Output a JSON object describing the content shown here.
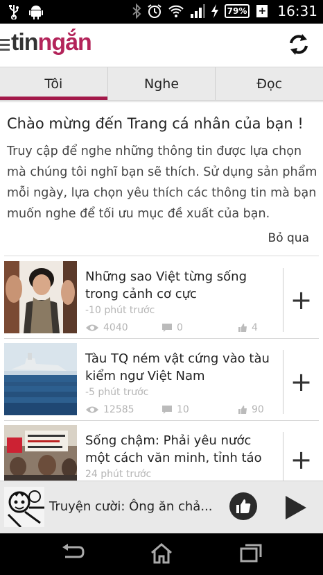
{
  "status_bar": {
    "icons": [
      "usb-icon",
      "android-icon",
      "bluetooth-icon",
      "alarm-icon",
      "wifi-icon",
      "signal-icon",
      "charging-icon"
    ],
    "battery": "79%",
    "battery_plus": "+",
    "time": "16:31"
  },
  "app_bar": {
    "logo_part1": "tin",
    "logo_part2": "ngắn",
    "refresh_icon": "refresh-icon"
  },
  "tabs": [
    {
      "label": "Tôi",
      "active": true
    },
    {
      "label": "Nghe",
      "active": false
    },
    {
      "label": "Đọc",
      "active": false
    }
  ],
  "welcome": {
    "title": "Chào mừng đến Trang cá nhân của bạn !",
    "body": "Truy cập để nghe những thông tin được lựa chọn mà chúng tôi nghĩ bạn sẽ thích. Sử dụng sản phẩm mỗi ngày, lựa chọn yêu thích các thông tin mà bạn muốn nghe để tối ưu mục đề xuất của bạn.",
    "skip": "Bỏ qua"
  },
  "news": [
    {
      "title": "Những sao Việt từng sống trong cảnh cơ cực",
      "time": "-10 phút trước",
      "views": "4040",
      "comments": "0",
      "likes": "4"
    },
    {
      "title": "Tàu TQ ném vật cứng vào tàu kiểm ngư Việt Nam",
      "time": "-5 phút trước",
      "views": "12585",
      "comments": "10",
      "likes": "90"
    },
    {
      "title": "Sống chậm: Phải yêu nước một cách văn minh, tỉnh táo",
      "time": "24 phút trước"
    }
  ],
  "add_label": "+",
  "player": {
    "title": "Truyện cười: Ông ăn chả..."
  },
  "colors": {
    "accent": "#a3194a",
    "logo_pink": "#b3245a",
    "tab_bg": "#eaeaea"
  }
}
